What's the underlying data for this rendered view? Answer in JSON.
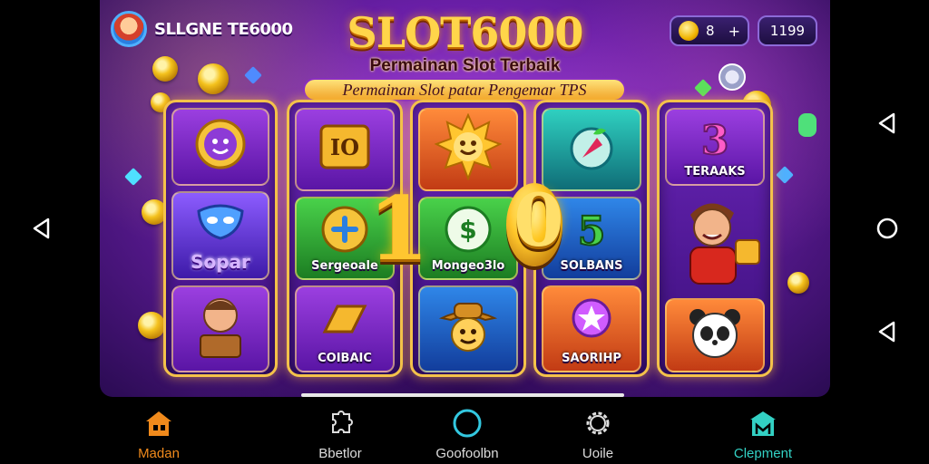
{
  "header": {
    "player_name": "SLLGNE TE6000",
    "logo_title": "SLOT6000",
    "logo_subtitle": "Permainan Slot Terbaik",
    "banner_text": "Permainan Slot patar Pengemar TPS",
    "coins": {
      "value": "8",
      "plus": "+"
    },
    "balance": "1199"
  },
  "reels": {
    "col1": {
      "label": "Sopar"
    },
    "col2": {
      "mid_label": "Sergeoale",
      "bottom_label": "COIBAIC",
      "top_label": "IO"
    },
    "col3": {
      "mid_label": "Mongeo3lo"
    },
    "col4": {
      "mid_label": "SOLBANS",
      "bottom_label": "SAORIHP"
    },
    "col5": {
      "top_label": "TERAAKS"
    },
    "big_digits": [
      "1",
      "0"
    ]
  },
  "bottom_nav": {
    "tabs": [
      {
        "label": "Madan",
        "icon": "home-icon",
        "color": "#f08a1c"
      },
      {
        "label": "Bbetlor",
        "icon": "puzzle-icon",
        "color": "#dddddd"
      },
      {
        "label": "Goofoolbn",
        "icon": "circle-icon",
        "color": "#dddddd"
      },
      {
        "label": "Uoile",
        "icon": "gear-icon",
        "color": "#dddddd"
      },
      {
        "label": "Clepment",
        "icon": "store-icon",
        "color": "#33d1c4"
      }
    ]
  },
  "colors": {
    "accent": "#ffd54a",
    "frame": "#f4c24a",
    "background": "#6a1fa8"
  }
}
